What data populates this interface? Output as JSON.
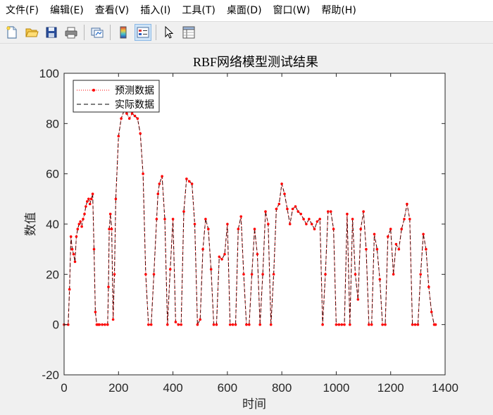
{
  "menu": {
    "items": [
      {
        "label": "文件(F)"
      },
      {
        "label": "编辑(E)"
      },
      {
        "label": "查看(V)"
      },
      {
        "label": "插入(I)"
      },
      {
        "label": "工具(T)"
      },
      {
        "label": "桌面(D)"
      },
      {
        "label": "窗口(W)"
      },
      {
        "label": "帮助(H)"
      }
    ]
  },
  "toolbar": {
    "buttons": [
      "new-file-icon",
      "open-folder-icon",
      "save-icon",
      "print-icon",
      "link-plot-icon",
      "colorbar-icon",
      "legend-icon",
      "pointer-icon",
      "property-inspector-icon"
    ],
    "active": "legend-icon"
  },
  "colors": {
    "predicted": "#ff0000",
    "actual": "#000000",
    "axis": "#262626",
    "background": "#f0f0f0"
  },
  "chart_data": {
    "type": "line",
    "title": "RBF网络模型测试结果",
    "xlabel": "时间",
    "ylabel": "数值",
    "xlim": [
      0,
      1400
    ],
    "ylim": [
      -20,
      100
    ],
    "xticks": [
      "0",
      "200",
      "400",
      "600",
      "800",
      "1000",
      "1200",
      "1400"
    ],
    "yticks": [
      "-20",
      "0",
      "20",
      "40",
      "60",
      "80",
      "100"
    ],
    "legend": {
      "position": "top-left",
      "entries": [
        "预测数据",
        "实际数据"
      ]
    },
    "series": [
      {
        "name": "预测数据",
        "style": "red dotted line with point markers",
        "x": [
          0,
          15,
          20,
          25,
          30,
          35,
          40,
          45,
          50,
          55,
          60,
          65,
          70,
          75,
          80,
          85,
          90,
          95,
          100,
          105,
          110,
          115,
          120,
          125,
          130,
          140,
          150,
          160,
          163,
          166,
          170,
          175,
          180,
          185,
          190,
          200,
          210,
          220,
          230,
          240,
          250,
          260,
          270,
          280,
          290,
          300,
          310,
          320,
          330,
          340,
          345,
          350,
          360,
          370,
          380,
          390,
          400,
          410,
          420,
          430,
          440,
          450,
          460,
          470,
          480,
          490,
          500,
          510,
          520,
          530,
          540,
          550,
          560,
          570,
          580,
          590,
          600,
          610,
          620,
          630,
          640,
          650,
          660,
          670,
          680,
          690,
          700,
          710,
          720,
          730,
          740,
          750,
          760,
          770,
          780,
          790,
          800,
          810,
          820,
          830,
          840,
          850,
          860,
          870,
          880,
          890,
          900,
          910,
          920,
          930,
          940,
          950,
          960,
          970,
          980,
          990,
          1000,
          1010,
          1020,
          1030,
          1040,
          1050,
          1060,
          1070,
          1080,
          1090,
          1100,
          1110,
          1120,
          1130,
          1140,
          1150,
          1160,
          1170,
          1180,
          1190,
          1200,
          1210,
          1220,
          1230,
          1240,
          1250,
          1260,
          1270,
          1280,
          1290,
          1300,
          1310,
          1320,
          1330,
          1340,
          1350,
          1360,
          1365
        ],
        "y": [
          0,
          0,
          14,
          35,
          30,
          28,
          25,
          35,
          38,
          40,
          41,
          39,
          42,
          44,
          47,
          49,
          50,
          48,
          50,
          52,
          30,
          5,
          0,
          0,
          0,
          0,
          0,
          0,
          15,
          38,
          44,
          38,
          2,
          20,
          50,
          75,
          82,
          85,
          84,
          82,
          84,
          83,
          82,
          76,
          60,
          20,
          0,
          0,
          20,
          42,
          52,
          56,
          59,
          42,
          0,
          22,
          42,
          1,
          0,
          0,
          45,
          58,
          57,
          56,
          40,
          0,
          2,
          30,
          42,
          38,
          22,
          0,
          0,
          27,
          26,
          28,
          40,
          0,
          0,
          0,
          38,
          43,
          20,
          0,
          0,
          20,
          38,
          28,
          0,
          20,
          45,
          40,
          0,
          20,
          46,
          48,
          56,
          52,
          46,
          40,
          46,
          47,
          45,
          44,
          42,
          40,
          42,
          40,
          38,
          41,
          42,
          0,
          20,
          45,
          45,
          38,
          0,
          0,
          0,
          0,
          44,
          0,
          42,
          20,
          10,
          38,
          45,
          30,
          0,
          0,
          36,
          30,
          18,
          0,
          0,
          35,
          38,
          20,
          32,
          30,
          38,
          42,
          48,
          42,
          0,
          0,
          0,
          20,
          36,
          30,
          15,
          5,
          0,
          0
        ],
        "marker": "."
      },
      {
        "name": "实际数据",
        "style": "black dashed line",
        "x": [
          0,
          15,
          20,
          25,
          30,
          35,
          40,
          45,
          50,
          55,
          60,
          65,
          70,
          75,
          80,
          85,
          90,
          95,
          100,
          105,
          110,
          115,
          120,
          125,
          130,
          140,
          150,
          160,
          163,
          166,
          170,
          175,
          180,
          185,
          190,
          200,
          210,
          220,
          230,
          240,
          250,
          260,
          270,
          280,
          290,
          300,
          310,
          320,
          330,
          340,
          345,
          350,
          360,
          370,
          380,
          390,
          400,
          410,
          420,
          430,
          440,
          450,
          460,
          470,
          480,
          490,
          500,
          510,
          520,
          530,
          540,
          550,
          560,
          570,
          580,
          590,
          600,
          610,
          620,
          630,
          640,
          650,
          660,
          670,
          680,
          690,
          700,
          710,
          720,
          730,
          740,
          750,
          760,
          770,
          780,
          790,
          800,
          810,
          820,
          830,
          840,
          850,
          860,
          870,
          880,
          890,
          900,
          910,
          920,
          930,
          940,
          950,
          960,
          970,
          980,
          990,
          1000,
          1010,
          1020,
          1030,
          1040,
          1050,
          1060,
          1070,
          1080,
          1090,
          1100,
          1110,
          1120,
          1130,
          1140,
          1150,
          1160,
          1170,
          1180,
          1190,
          1200,
          1210,
          1220,
          1230,
          1240,
          1250,
          1260,
          1270,
          1280,
          1290,
          1300,
          1310,
          1320,
          1330,
          1340,
          1350,
          1360,
          1365
        ],
        "y": [
          0,
          0,
          14,
          35,
          30,
          28,
          25,
          35,
          38,
          40,
          41,
          39,
          42,
          44,
          47,
          49,
          50,
          48,
          50,
          52,
          30,
          5,
          0,
          0,
          0,
          0,
          0,
          0,
          15,
          38,
          44,
          38,
          2,
          20,
          50,
          75,
          82,
          85,
          84,
          82,
          84,
          83,
          82,
          76,
          60,
          20,
          0,
          0,
          20,
          42,
          52,
          56,
          59,
          42,
          0,
          22,
          42,
          1,
          0,
          0,
          45,
          58,
          57,
          56,
          40,
          0,
          2,
          30,
          42,
          38,
          22,
          0,
          0,
          27,
          26,
          28,
          40,
          0,
          0,
          0,
          38,
          43,
          20,
          0,
          0,
          20,
          38,
          28,
          0,
          20,
          45,
          40,
          0,
          20,
          46,
          48,
          56,
          52,
          46,
          40,
          46,
          47,
          45,
          44,
          42,
          40,
          42,
          40,
          38,
          41,
          42,
          0,
          20,
          45,
          45,
          38,
          0,
          0,
          0,
          0,
          44,
          0,
          42,
          20,
          10,
          38,
          45,
          30,
          0,
          0,
          36,
          30,
          18,
          0,
          0,
          35,
          38,
          20,
          32,
          30,
          38,
          42,
          48,
          42,
          0,
          0,
          0,
          20,
          36,
          30,
          15,
          5,
          0,
          0
        ]
      }
    ]
  }
}
